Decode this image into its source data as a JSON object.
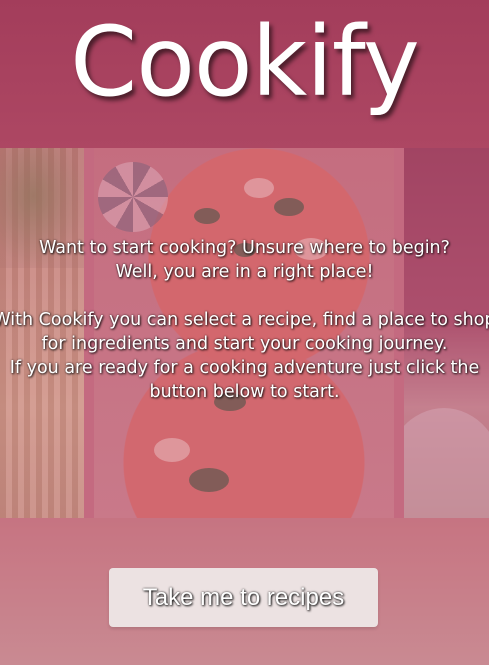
{
  "app": {
    "logo_text": "Cookify"
  },
  "intro": {
    "line1": "Want to start cooking? Unsure where to begin?",
    "line2": "Well, you are in a right place!",
    "line3": "With Cookify you can select a recipe, find a place to shop for ingredients and start your cooking journey.",
    "line4": "If you are ready for a cooking adventure just click the button below to start."
  },
  "cta": {
    "label": "Take me to recipes"
  },
  "colors": {
    "brand_primary": "#a8425e",
    "button_bg": "#ece2e2",
    "text": "#ffffff"
  }
}
